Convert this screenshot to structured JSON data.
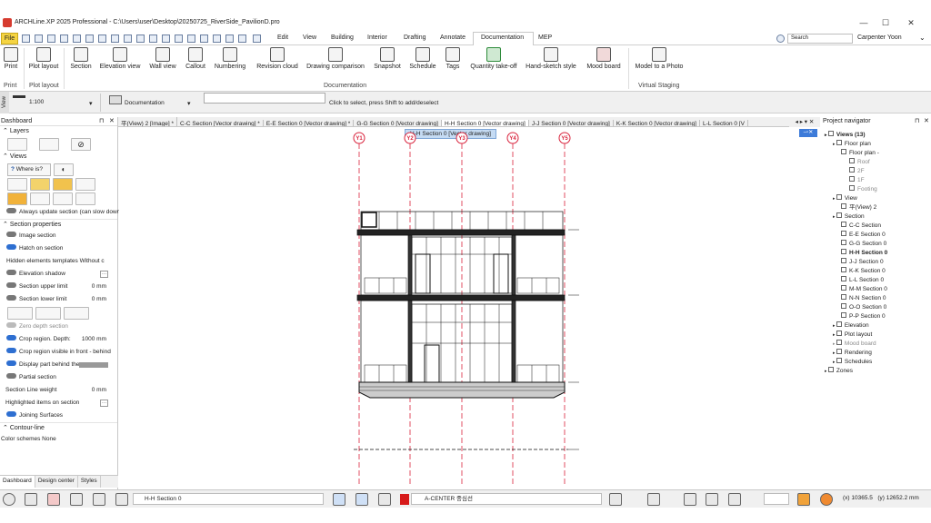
{
  "window": {
    "title": "ARCHLine.XP 2025 Professional - C:\\Users\\user\\Desktop\\20250725_RiverSide_PavilionD.pro",
    "minimize": "—",
    "maximize": "☐",
    "close": "✕"
  },
  "menu": {
    "file": "File",
    "tabs": [
      "Edit",
      "View",
      "Building",
      "Interior",
      "Drafting",
      "Annotate",
      "Documentation",
      "MEP"
    ],
    "active_tab": "Documentation",
    "search_placeholder": "Search",
    "user": "Carpenter Yoon"
  },
  "ribbon": {
    "items": [
      {
        "label": "Print",
        "icon": "printer-icon"
      },
      {
        "label": "Plot layout",
        "icon": "plot-layout-icon"
      },
      {
        "label": "Section",
        "icon": "section-icon"
      },
      {
        "label": "Elevation view",
        "icon": "elevation-icon"
      },
      {
        "label": "Wall view",
        "icon": "wall-view-icon"
      },
      {
        "label": "Callout",
        "icon": "callout-icon"
      },
      {
        "label": "Numbering",
        "icon": "numbering-icon"
      },
      {
        "label": "Revision cloud",
        "icon": "revision-cloud-icon"
      },
      {
        "label": "Drawing comparison",
        "icon": "drawing-comparison-icon"
      },
      {
        "label": "Snapshot",
        "icon": "camera-icon"
      },
      {
        "label": "Schedule",
        "icon": "schedule-icon"
      },
      {
        "label": "Tags",
        "icon": "tag-icon"
      },
      {
        "label": "Quantity take-off",
        "icon": "excel-icon"
      },
      {
        "label": "Hand-sketch style",
        "icon": "hand-sketch-icon"
      },
      {
        "label": "Mood board",
        "icon": "mood-board-icon"
      },
      {
        "label": "Model to a Photo",
        "icon": "model-photo-icon"
      }
    ],
    "groups": [
      "Print",
      "Plot layout",
      "Documentation",
      "Virtual Staging"
    ]
  },
  "viewbar": {
    "side_label": "View",
    "scale": "1:100",
    "mode": "Documentation",
    "prompt": "Click to select, press Shift to add/deselect"
  },
  "dashboard": {
    "title": "Dashboard",
    "sections": {
      "layers": "Layers",
      "views": "Views",
      "where_is": "Where is?",
      "always_update": "Always update section (can slow down",
      "section_properties": "Section properties",
      "contour_line": "Contour-line"
    },
    "props": {
      "image_section": "Image section",
      "hatch_on_section": "Hatch on section",
      "hidden_elements": "Hidden elements templates",
      "hidden_elements_value": "Without c",
      "elevation_shadow": "Elevation shadow",
      "upper_limit": "Section upper limit",
      "upper_limit_val": "0 mm",
      "lower_limit": "Section lower limit",
      "lower_limit_val": "0 mm",
      "zero_depth": "Zero depth section",
      "crop_depth": "Crop region. Depth:",
      "crop_depth_val": "1000 mm",
      "crop_visible": "Crop region visible in front - behind",
      "display_part": "Display part behind the",
      "partial_section": "Partial section",
      "line_weight": "Section Line weight",
      "line_weight_val": "0 mm",
      "highlighted": "Highlighted items on section",
      "joining": "Joining Surfaces",
      "color_schemes": "Color schemes",
      "color_schemes_val": "None"
    },
    "tabs": [
      "Dashboard",
      "Design center",
      "Styles"
    ]
  },
  "doc_tabs": [
    "平(View) 2 [Image] *",
    "C-C Section [Vector drawing] *",
    "E-E Section 0 [Vector drawing] *",
    "G-G Section 0 [Vector drawing]",
    "H-H Section 0 [Vector drawing]",
    "J-J Section 0 [Vector drawing]",
    "K-K Section 0 [Vector drawing]",
    "L-L Section 0 [V"
  ],
  "canvas": {
    "view_label": "H-H Section 0 [Vector drawing]",
    "grid_labels": [
      "Y1",
      "Y2",
      "Y3",
      "Y4",
      "Y5"
    ]
  },
  "navigator": {
    "title": "Project navigator",
    "items": [
      {
        "label": "Views (13)",
        "level": 0,
        "bold": true
      },
      {
        "label": "Floor plan",
        "level": 1
      },
      {
        "label": "Floor plan -",
        "level": 2
      },
      {
        "label": "Roof",
        "level": 3,
        "dim": true
      },
      {
        "label": "2F",
        "level": 3,
        "dim": true
      },
      {
        "label": "1F",
        "level": 3,
        "dim": true
      },
      {
        "label": "Footing",
        "level": 3,
        "dim": true
      },
      {
        "label": "View",
        "level": 1
      },
      {
        "label": "平(View) 2",
        "level": 2
      },
      {
        "label": "Section",
        "level": 1
      },
      {
        "label": "C-C Section",
        "level": 2
      },
      {
        "label": "E-E Section 0",
        "level": 2
      },
      {
        "label": "G-G Section 0",
        "level": 2
      },
      {
        "label": "H-H Section 0",
        "level": 2,
        "bold": true
      },
      {
        "label": "J-J Section 0",
        "level": 2
      },
      {
        "label": "K-K Section 0",
        "level": 2
      },
      {
        "label": "L-L Section 0",
        "level": 2
      },
      {
        "label": "M-M Section 0",
        "level": 2
      },
      {
        "label": "N-N Section 0",
        "level": 2
      },
      {
        "label": "O-O Section 0",
        "level": 2
      },
      {
        "label": "P-P Section 0",
        "level": 2
      },
      {
        "label": "Elevation",
        "level": 1
      },
      {
        "label": "Plot layout",
        "level": 1
      },
      {
        "label": "Mood board",
        "level": 1,
        "dim": true
      },
      {
        "label": "Rendering",
        "level": 1
      },
      {
        "label": "Schedules",
        "level": 1
      },
      {
        "label": "Zones",
        "level": 0
      }
    ]
  },
  "status": {
    "layer": "H-H Section 0",
    "layer2": "A-CENTER 중심선",
    "coord_x": "(x) 10365.5",
    "coord_y": "(y) 12652.2 mm"
  }
}
